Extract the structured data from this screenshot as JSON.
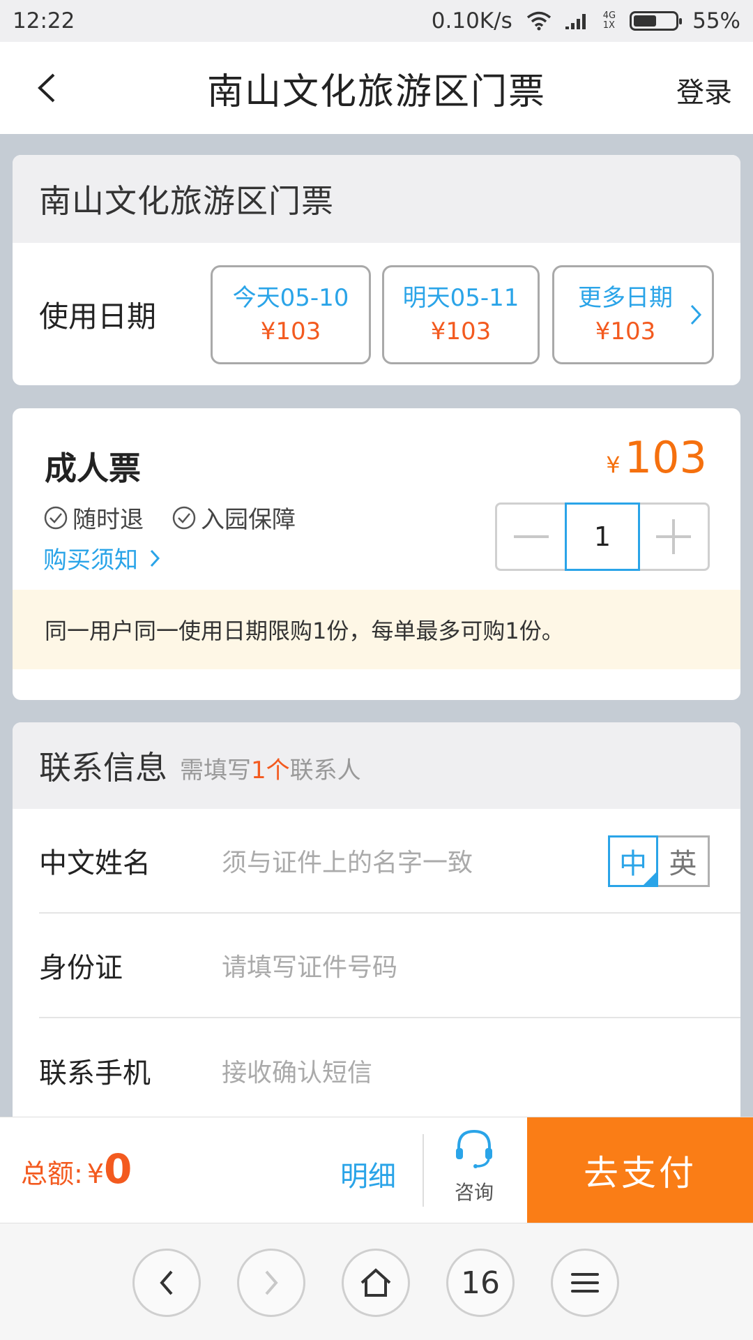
{
  "status_bar": {
    "time": "12:22",
    "net_speed": "0.10K/s",
    "net_top": "4G",
    "net_bottom": "1X",
    "battery": "55%"
  },
  "header": {
    "title": "南山文化旅游区门票",
    "login": "登录"
  },
  "ticket_card": {
    "title": "南山文化旅游区门票",
    "date_label": "使用日期",
    "dates": [
      {
        "day": "今天05-10",
        "price": "¥103"
      },
      {
        "day": "明天05-11",
        "price": "¥103"
      },
      {
        "day": "更多日期",
        "price": "¥103"
      }
    ]
  },
  "adult_ticket": {
    "name": "成人票",
    "currency": "¥",
    "price": "103",
    "tags": [
      "随时退",
      "入园保障"
    ],
    "notice_link": "购买须知",
    "quantity": "1",
    "limit_notice": "同一用户同一使用日期限购1份，每单最多可购1份。"
  },
  "contact": {
    "title": "联系信息",
    "sub_prefix": "需填写",
    "sub_highlight": "1个",
    "sub_suffix": "联系人",
    "fields": [
      {
        "label": "中文姓名",
        "placeholder": "须与证件上的名字一致"
      },
      {
        "label": "身份证",
        "placeholder": "请填写证件号码"
      },
      {
        "label": "联系手机",
        "placeholder": "接收确认短信"
      }
    ],
    "lang_zh": "中",
    "lang_en": "英"
  },
  "action_bar": {
    "total_label": "总额:",
    "currency": "¥",
    "total_value": "0",
    "detail": "明细",
    "consult": "咨询",
    "pay": "去支付"
  },
  "browser_nav": {
    "tabs_count": "16"
  },
  "colors": {
    "accent_blue": "#2aa4e8",
    "price_orange": "#f5700e",
    "pay_button": "#fa7d16"
  }
}
